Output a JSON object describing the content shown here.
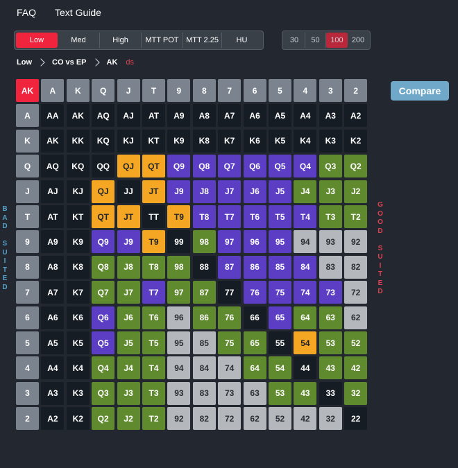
{
  "nav": {
    "faq": "FAQ",
    "text_guide": "Text Guide"
  },
  "range_tabs": [
    "Low",
    "Med",
    "High",
    "MTT POT",
    "MTT 2.25",
    "HU"
  ],
  "range_active": "Low",
  "stack_tabs": [
    "30",
    "50",
    "100",
    "200"
  ],
  "stack_active": "100",
  "breadcrumb": {
    "items": [
      "Low",
      "CO vs EP",
      "AK"
    ],
    "suffix": "ds"
  },
  "compare_label": "Compare",
  "bad_suited_label": "BAD SUITED",
  "good_suited_label": "GOOD SUITED",
  "colors": {
    "fold": "#161c24",
    "purple": "#5b3ec4",
    "green": "#5f8a2e",
    "orange": "#f5a623",
    "gray": "#b4b8bc",
    "header": "#7b848e",
    "accent": "#f0243c"
  },
  "grid": {
    "corner": "AK",
    "ranks": [
      "A",
      "K",
      "Q",
      "J",
      "T",
      "9",
      "8",
      "7",
      "6",
      "5",
      "4",
      "3",
      "2"
    ],
    "rows": [
      [
        "AA",
        "AK",
        "AQ",
        "AJ",
        "AT",
        "A9",
        "A8",
        "A7",
        "A6",
        "A5",
        "A4",
        "A3",
        "A2"
      ],
      [
        "AK",
        "KK",
        "KQ",
        "KJ",
        "KT",
        "K9",
        "K8",
        "K7",
        "K6",
        "K5",
        "K4",
        "K3",
        "K2"
      ],
      [
        "AQ",
        "KQ",
        "QQ",
        "QJ",
        "QT",
        "Q9",
        "Q8",
        "Q7",
        "Q6",
        "Q5",
        "Q4",
        "Q3",
        "Q2"
      ],
      [
        "AJ",
        "KJ",
        "QJ",
        "JJ",
        "JT",
        "J9",
        "J8",
        "J7",
        "J6",
        "J5",
        "J4",
        "J3",
        "J2"
      ],
      [
        "AT",
        "KT",
        "QT",
        "JT",
        "TT",
        "T9",
        "T8",
        "T7",
        "T6",
        "T5",
        "T4",
        "T3",
        "T2"
      ],
      [
        "A9",
        "K9",
        "Q9",
        "J9",
        "T9",
        "99",
        "98",
        "97",
        "96",
        "95",
        "94",
        "93",
        "92"
      ],
      [
        "A8",
        "K8",
        "Q8",
        "J8",
        "T8",
        "98",
        "88",
        "87",
        "86",
        "85",
        "84",
        "83",
        "82"
      ],
      [
        "A7",
        "K7",
        "Q7",
        "J7",
        "T7",
        "97",
        "87",
        "77",
        "76",
        "75",
        "74",
        "73",
        "72"
      ],
      [
        "A6",
        "K6",
        "Q6",
        "J6",
        "T6",
        "96",
        "86",
        "76",
        "66",
        "65",
        "64",
        "63",
        "62"
      ],
      [
        "A5",
        "K5",
        "Q5",
        "J5",
        "T5",
        "95",
        "85",
        "75",
        "65",
        "55",
        "54",
        "53",
        "52"
      ],
      [
        "A4",
        "K4",
        "Q4",
        "J4",
        "T4",
        "94",
        "84",
        "74",
        "64",
        "54",
        "44",
        "43",
        "42"
      ],
      [
        "A3",
        "K3",
        "Q3",
        "J3",
        "T3",
        "93",
        "83",
        "73",
        "63",
        "53",
        "43",
        "33",
        "32"
      ],
      [
        "A2",
        "K2",
        "Q2",
        "J2",
        "T2",
        "92",
        "82",
        "72",
        "62",
        "52",
        "42",
        "32",
        "22"
      ]
    ],
    "cell_colors": [
      [
        "fold",
        "fold",
        "fold",
        "fold",
        "fold",
        "fold",
        "fold",
        "fold",
        "fold",
        "fold",
        "fold",
        "fold",
        "fold"
      ],
      [
        "fold",
        "fold",
        "fold",
        "fold",
        "fold",
        "fold",
        "fold",
        "fold",
        "fold",
        "fold",
        "fold",
        "fold",
        "fold"
      ],
      [
        "fold",
        "fold",
        "fold",
        "orange",
        "orange",
        "purple",
        "purple",
        "purple",
        "purple",
        "purple",
        "purple",
        "green",
        "green"
      ],
      [
        "fold",
        "fold",
        "orange",
        "fold",
        "orange",
        "purple",
        "purple",
        "purple",
        "purple",
        "purple",
        "green",
        "green",
        "green"
      ],
      [
        "fold",
        "fold",
        "orange",
        "orange",
        "fold",
        "orange",
        "purple",
        "purple",
        "purple",
        "purple",
        "purple",
        "green",
        "green"
      ],
      [
        "fold",
        "fold",
        "purple",
        "purple",
        "orange",
        "fold",
        "green",
        "purple",
        "purple",
        "purple",
        "gray",
        "gray",
        "gray"
      ],
      [
        "fold",
        "fold",
        "green",
        "green",
        "green",
        "green",
        "fold",
        "purple",
        "purple",
        "purple",
        "purple",
        "gray",
        "gray"
      ],
      [
        "fold",
        "fold",
        "green",
        "green",
        "purple",
        "green",
        "green",
        "fold",
        "purple",
        "purple",
        "purple",
        "purple",
        "gray"
      ],
      [
        "fold",
        "fold",
        "purple",
        "green",
        "green",
        "gray",
        "green",
        "green",
        "fold",
        "purple",
        "green",
        "green",
        "gray"
      ],
      [
        "fold",
        "fold",
        "purple",
        "green",
        "green",
        "gray",
        "gray",
        "green",
        "green",
        "fold",
        "orange",
        "green",
        "green"
      ],
      [
        "fold",
        "fold",
        "green",
        "green",
        "green",
        "gray",
        "gray",
        "gray",
        "green",
        "green",
        "fold",
        "green",
        "green"
      ],
      [
        "fold",
        "fold",
        "green",
        "green",
        "green",
        "gray",
        "gray",
        "gray",
        "gray",
        "green",
        "green",
        "fold",
        "green"
      ],
      [
        "fold",
        "fold",
        "green",
        "green",
        "green",
        "gray",
        "gray",
        "gray",
        "gray",
        "gray",
        "gray",
        "gray",
        "fold"
      ]
    ]
  }
}
